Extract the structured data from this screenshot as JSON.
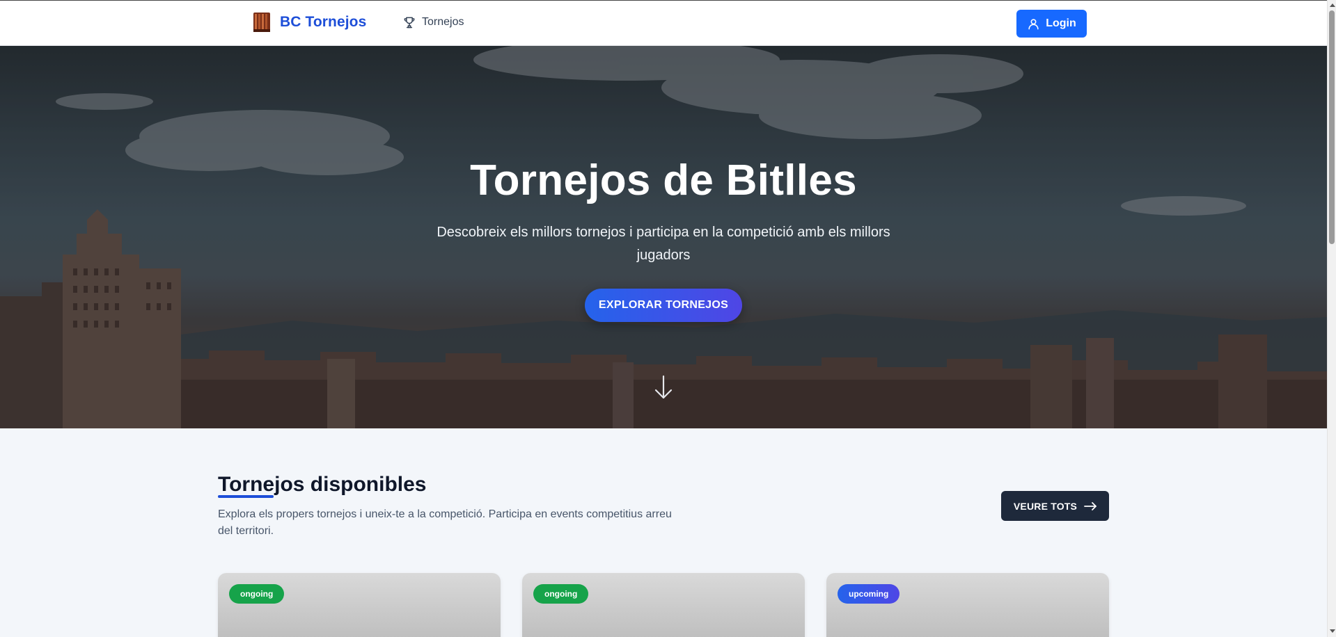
{
  "nav": {
    "brand": "BC Tornejos",
    "link_tornejos": "Tornejos",
    "login": "Login"
  },
  "hero": {
    "title": "Tornejos de Bitlles",
    "subtitle": "Descobreix els millors tornejos i participa en la competició amb els millors jugadors",
    "cta": "EXPLORAR TORNEJOS"
  },
  "section": {
    "title": "Tornejos disponibles",
    "description": "Explora els propers tornejos i uneix-te a la competició. Participa en events competitius arreu del territori.",
    "see_all": "VEURE TOTS"
  },
  "cards": [
    {
      "status": "ongoing",
      "status_color": "#16a34a"
    },
    {
      "status": "ongoing",
      "status_color": "#16a34a"
    },
    {
      "status": "upcoming",
      "status_color": "#4f46e5"
    }
  ],
  "colors": {
    "brand": "#1d4ed8",
    "login_bg": "#1769ff",
    "see_all_bg": "#1e293b"
  }
}
